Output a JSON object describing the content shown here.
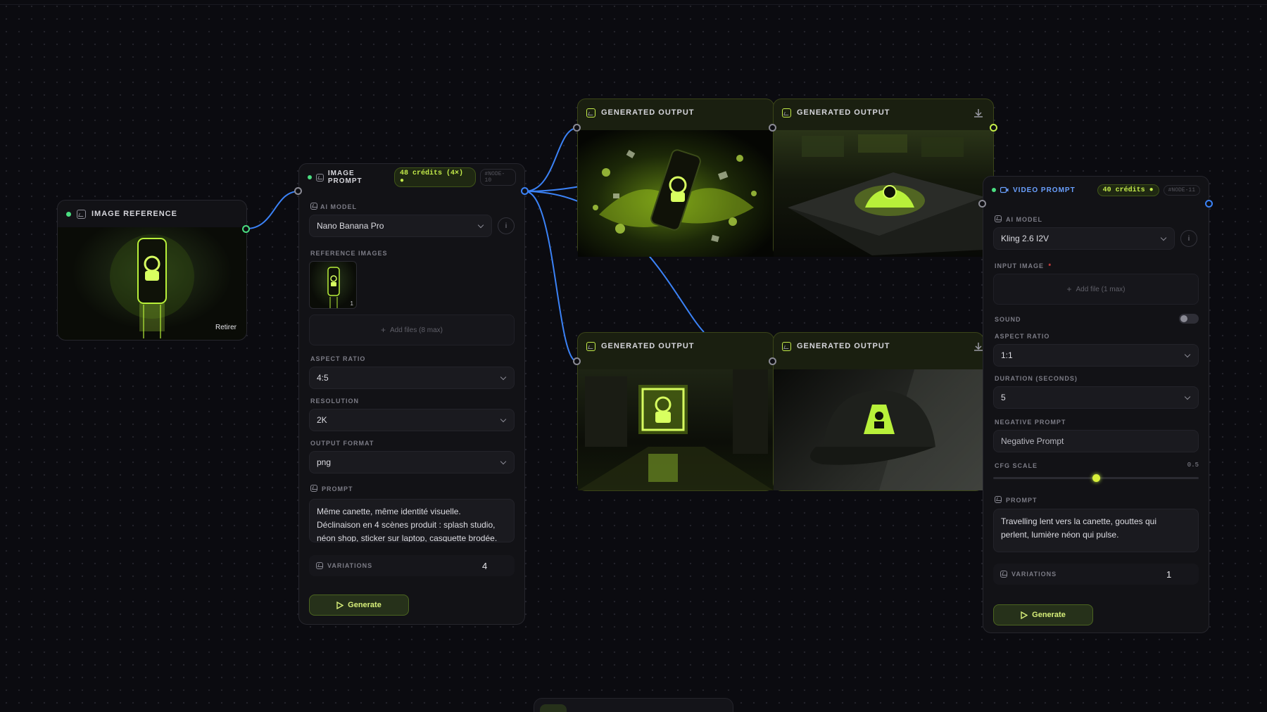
{
  "colors": {
    "background": "#0b0b10",
    "accent_lime": "#c4ec4a",
    "status_green": "#4ade80",
    "edge_blue": "#3b82f6"
  },
  "image_reference": {
    "title": "IMAGE REFERENCE",
    "remove_label": "Retirer",
    "icon": "image-icon"
  },
  "image_prompt": {
    "title": "IMAGE PROMPT",
    "credits": "48 crédits (4×) ●",
    "node_id": "#NODE-10",
    "ai_model_label": "AI MODEL",
    "ai_model_value": "Nano Banana Pro",
    "reference_images_label": "REFERENCE IMAGES",
    "reference_count": "1",
    "add_files": "Add files (8 max)",
    "aspect_ratio_label": "ASPECT RATIO",
    "aspect_ratio_value": "4:5",
    "resolution_label": "RESOLUTION",
    "resolution_value": "2K",
    "output_format_label": "OUTPUT FORMAT",
    "output_format_value": "png",
    "prompt_label": "PROMPT",
    "prompt_line1": "Même canette, même identité visuelle.",
    "prompt_line2": "Déclinaison en 4 scènes produit : splash studio,",
    "prompt_line3": "néon shop, sticker sur laptop, casquette brodée.",
    "variations_label": "VARIATIONS",
    "variations_value": "4",
    "generate_label": "Generate"
  },
  "outputs": [
    {
      "title": "GENERATED OUTPUT",
      "scene": "splash studio"
    },
    {
      "title": "GENERATED OUTPUT",
      "scene": "sticker sur laptop"
    },
    {
      "title": "GENERATED OUTPUT",
      "scene": "néon shop"
    },
    {
      "title": "GENERATED OUTPUT",
      "scene": "casquette brodée"
    }
  ],
  "video_prompt": {
    "title": "VIDEO PROMPT",
    "credits": "40 crédits ●",
    "node_id": "#NODE-11",
    "ai_model_label": "AI MODEL",
    "ai_model_value": "Kling 2.6 I2V",
    "input_image_label": "INPUT IMAGE",
    "required_mark": "*",
    "add_file": "Add file (1 max)",
    "sound_label": "SOUND",
    "sound_on": false,
    "aspect_ratio_label": "ASPECT RATIO",
    "aspect_ratio_value": "1:1",
    "duration_label": "DURATION (SECONDS)",
    "duration_value": "5",
    "negative_prompt_label": "NEGATIVE PROMPT",
    "negative_prompt_placeholder": "Negative Prompt",
    "cfg_label": "CFG SCALE",
    "cfg_value": "0.5",
    "cfg_fraction": 0.5,
    "prompt_label": "PROMPT",
    "prompt_line1": "Travelling lent vers la canette, gouttes qui",
    "prompt_line2": "perlent, lumière néon qui pulse.",
    "variations_label": "VARIATIONS",
    "variations_value": "1",
    "generate_label": "Generate"
  }
}
